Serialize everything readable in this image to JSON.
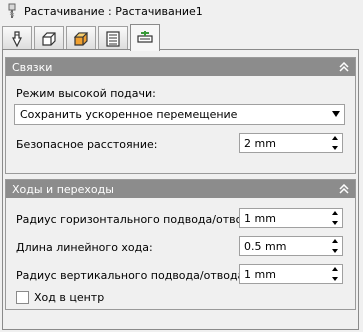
{
  "window": {
    "title": "Растачивание : Растачивание1",
    "icon": "drill-icon"
  },
  "tabs": [
    {
      "icon": "tool-icon"
    },
    {
      "icon": "stock-box-icon"
    },
    {
      "icon": "orange-box-icon"
    },
    {
      "icon": "list-icon"
    },
    {
      "icon": "links-icon",
      "active": true
    }
  ],
  "links": {
    "header": "Связки",
    "feed_mode_label": "Режим высокой подачи:",
    "feed_mode_value": "Сохранить ускоренное перемещение",
    "safe_distance_label": "Безопасное расстояние:",
    "safe_distance_value": "2 mm"
  },
  "passes": {
    "header": "Ходы и переходы",
    "horiz_radius_label": "Радиус горизонтального подвода/отвода:",
    "horiz_radius_value": "1 mm",
    "linear_length_label": "Длина линейного хода:",
    "linear_length_value": "0.5 mm",
    "vert_radius_label": "Радиус вертикального подвода/отвода:",
    "vert_radius_value": "1 mm",
    "center_checkbox_label": "Ход в центр",
    "center_checked": false
  },
  "colors": {
    "section_header": "#8c8c8c",
    "tab_orange": "#f0a030",
    "tab_green": "#3a9a3a"
  }
}
